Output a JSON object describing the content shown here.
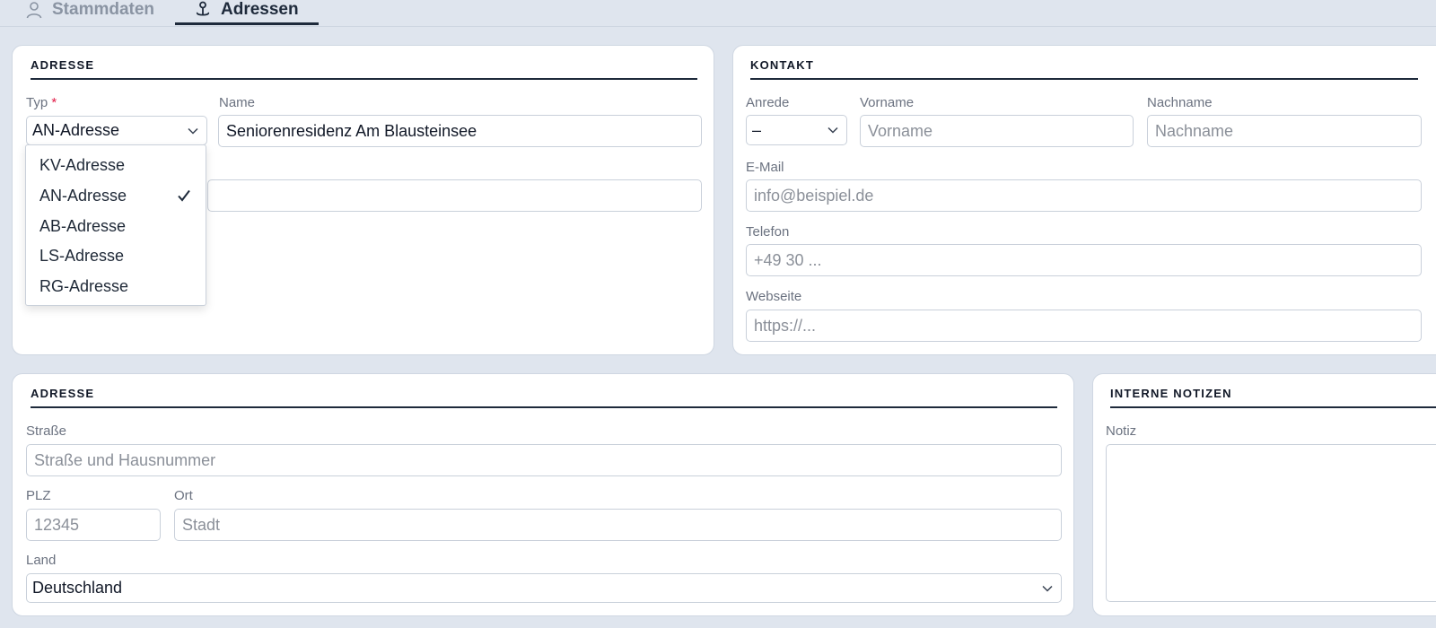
{
  "tabs": {
    "stammdaten": "Stammdaten",
    "adressen": "Adressen"
  },
  "address_card": {
    "title": "ADRESSE",
    "typ_label": "Typ",
    "required_mark": "*",
    "typ_value": "AN-Adresse",
    "name_label": "Name",
    "name_value": "Seniorenresidenz Am Blausteinsee",
    "dropdown_options": [
      "KV-Adresse",
      "AN-Adresse",
      "AB-Adresse",
      "LS-Adresse",
      "RG-Adresse"
    ],
    "dropdown_selected": "AN-Adresse"
  },
  "contact_card": {
    "title": "KONTAKT",
    "anrede_label": "Anrede",
    "anrede_value": "–",
    "vorname_label": "Vorname",
    "vorname_placeholder": "Vorname",
    "nachname_label": "Nachname",
    "nachname_placeholder": "Nachname",
    "email_label": "E-Mail",
    "email_placeholder": "info@beispiel.de",
    "telefon_label": "Telefon",
    "telefon_placeholder": "+49 30 ...",
    "webseite_label": "Webseite",
    "webseite_placeholder": "https://..."
  },
  "street_card": {
    "title": "ADRESSE",
    "strasse_label": "Straße",
    "strasse_placeholder": "Straße und Hausnummer",
    "plz_label": "PLZ",
    "plz_placeholder": "12345",
    "ort_label": "Ort",
    "ort_placeholder": "Stadt",
    "land_label": "Land",
    "land_value": "Deutschland"
  },
  "notes_card": {
    "title": "INTERNE NOTIZEN",
    "notiz_label": "Notiz"
  },
  "colors": {
    "background": "#dfe5ee",
    "accent": "#1e2a3b",
    "required": "#e11d48"
  }
}
